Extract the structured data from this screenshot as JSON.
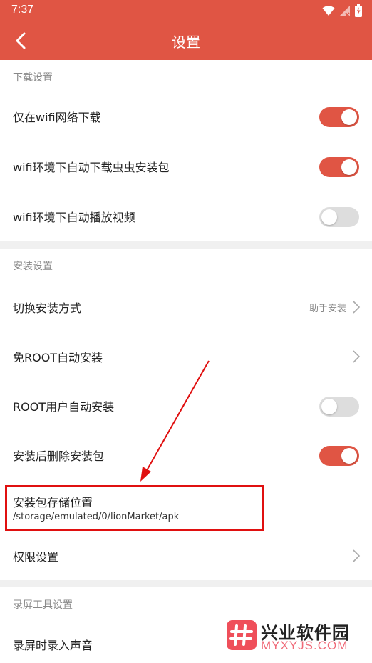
{
  "status_bar": {
    "time": "7:37",
    "icons": [
      "wifi-icon",
      "signal-icon",
      "battery-icon"
    ]
  },
  "app_bar": {
    "title": "设置",
    "back_icon": "back-arrow-icon"
  },
  "colors": {
    "accent": "#e05544",
    "toggle_off": "#dddddd",
    "highlight": "#e01010"
  },
  "sections": {
    "download": {
      "header": "下载设置",
      "wifi_only": {
        "label": "仅在wifi网络下载",
        "enabled": true
      },
      "auto_download_pkg": {
        "label": "wifi环境下自动下载虫虫安装包",
        "enabled": true
      },
      "auto_play_video": {
        "label": "wifi环境下自动播放视频",
        "enabled": false
      }
    },
    "install": {
      "header": "安装设置",
      "install_method": {
        "label": "切换安装方式",
        "value": "助手安装"
      },
      "root_free_install": {
        "label": "免ROOT自动安装"
      },
      "root_user_install": {
        "label": "ROOT用户自动安装",
        "enabled": false
      },
      "delete_after_install": {
        "label": "安装后删除安装包",
        "enabled": true
      },
      "storage_location": {
        "label": "安装包存储位置",
        "path": "/storage/emulated/0/lionMarket/apk"
      },
      "permissions": {
        "label": "权限设置"
      }
    },
    "recorder": {
      "header": "录屏工具设置",
      "record_audio": {
        "label": "录屏时录入声音"
      }
    }
  },
  "watermark": {
    "name": "兴业软件园",
    "url": "MYXYJS.COM"
  }
}
